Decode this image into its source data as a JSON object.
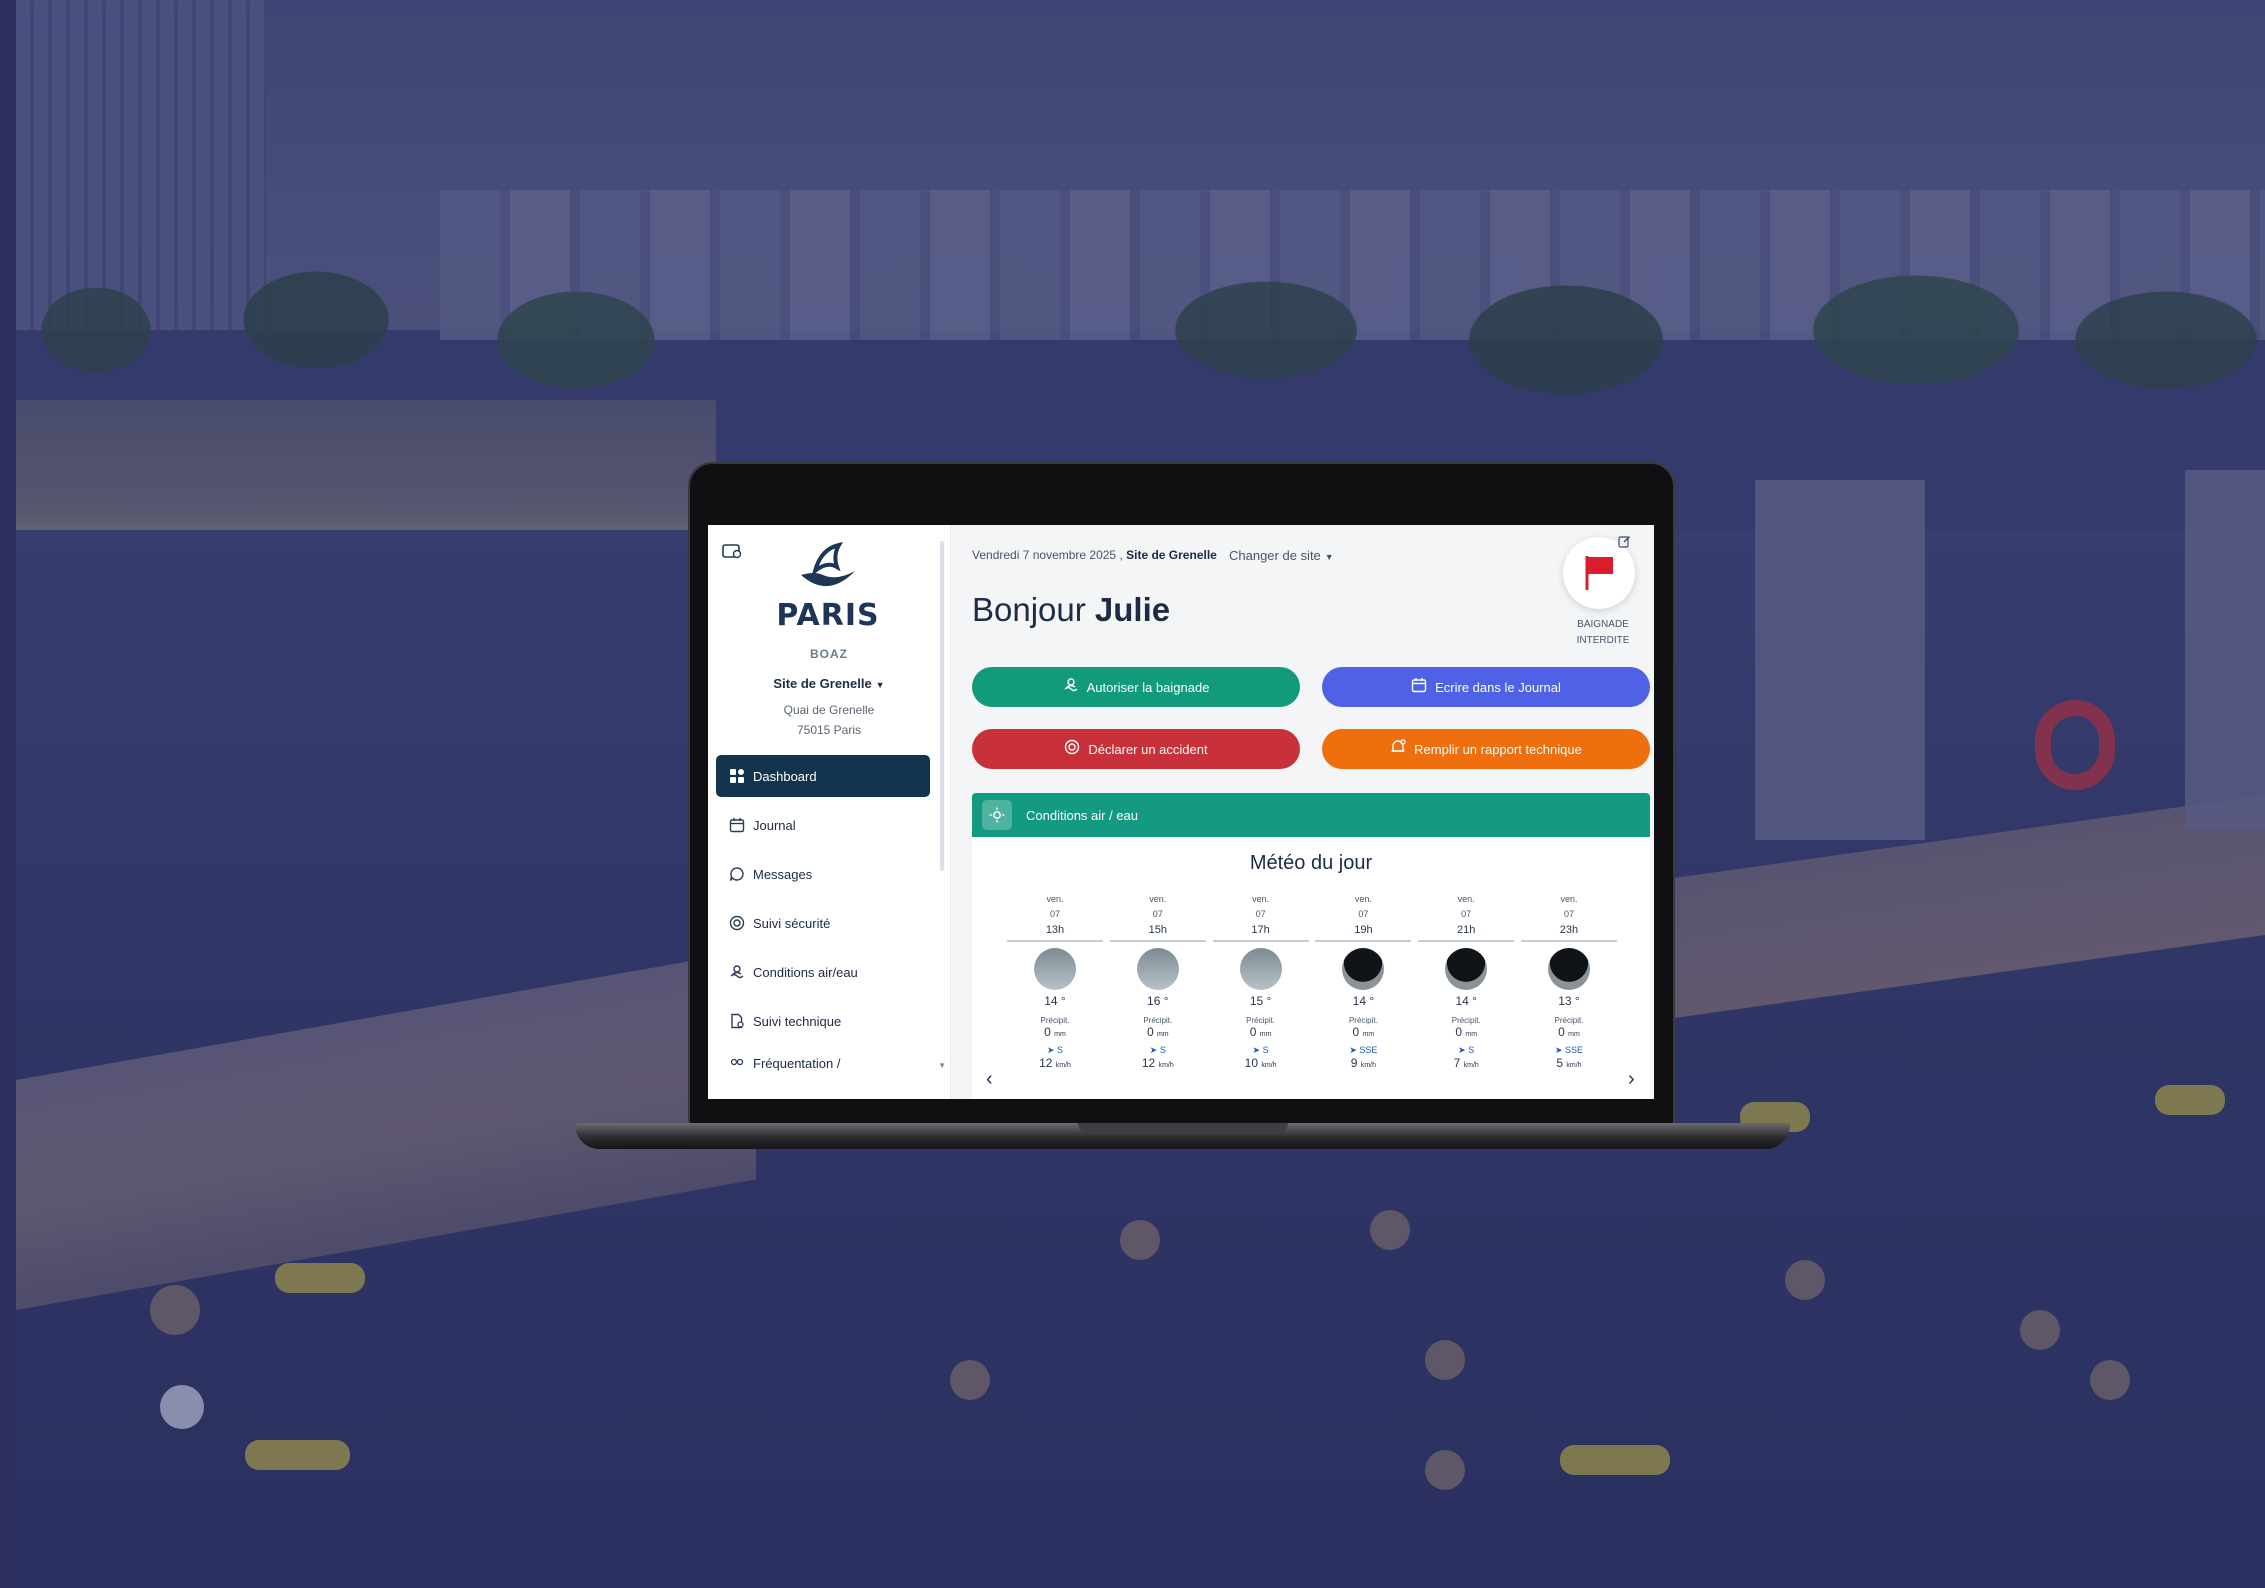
{
  "app": {
    "brand": "PARIS",
    "sub_brand": "BOAZ",
    "site_name": "Site de Grenelle",
    "site_address_line1": "Quai de Grenelle",
    "site_address_line2": "75015 Paris"
  },
  "sidebar": {
    "items": [
      {
        "label": "Dashboard",
        "icon": "grid-icon",
        "active": true
      },
      {
        "label": "Journal",
        "icon": "calendar-icon",
        "active": false
      },
      {
        "label": "Messages",
        "icon": "chat-icon",
        "active": false
      },
      {
        "label": "Suivi sécurité",
        "icon": "lifebuoy-icon",
        "active": false
      },
      {
        "label": "Conditions air/eau",
        "icon": "swimmer-icon",
        "active": false
      },
      {
        "label": "Suivi technique",
        "icon": "document-gear-icon",
        "active": false
      },
      {
        "label": "Fréquentation /",
        "icon": "people-icon",
        "active": false
      }
    ]
  },
  "header": {
    "date": "Vendredi 7 novembre 2025",
    "separator": " , ",
    "site": "Site de Grenelle",
    "change_site": "Changer de site",
    "greeting_prefix": "Bonjour ",
    "greeting_name": "Julie",
    "flag_status": "BAIGNADE INTERDITE",
    "flag_color": "#d81e2a"
  },
  "actions": {
    "authorize": "Autoriser la baignade",
    "journal": "Ecrire dans le Journal",
    "accident": "Déclarer un accident",
    "report": "Remplir un rapport technique"
  },
  "conditions": {
    "panel_title": "Conditions air / eau",
    "meteo_title": "Météo du jour",
    "precip_label": "Précipit.",
    "precip_unit": "mm",
    "wind_unit": "km/h",
    "forecast": [
      {
        "day": "ven.",
        "date": "07",
        "hour": "13h",
        "sky": "cloudy",
        "temp": "14 °",
        "precip": "0",
        "dir": "S",
        "wind": "12"
      },
      {
        "day": "ven.",
        "date": "07",
        "hour": "15h",
        "sky": "cloudy",
        "temp": "16 °",
        "precip": "0",
        "dir": "S",
        "wind": "12"
      },
      {
        "day": "ven.",
        "date": "07",
        "hour": "17h",
        "sky": "cloudy",
        "temp": "15 °",
        "precip": "0",
        "dir": "S",
        "wind": "10"
      },
      {
        "day": "ven.",
        "date": "07",
        "hour": "19h",
        "sky": "night",
        "temp": "14 °",
        "precip": "0",
        "dir": "SSE",
        "wind": "9"
      },
      {
        "day": "ven.",
        "date": "07",
        "hour": "21h",
        "sky": "night",
        "temp": "14 °",
        "precip": "0",
        "dir": "S",
        "wind": "7"
      },
      {
        "day": "ven.",
        "date": "07",
        "hour": "23h",
        "sky": "night",
        "temp": "13 °",
        "precip": "0",
        "dir": "SSE",
        "wind": "5"
      }
    ]
  },
  "colors": {
    "sidebar_active": "#12344d",
    "green": "#129a7c",
    "blue": "#4f62e6",
    "red": "#c8303a",
    "orange": "#ef6f0f",
    "panel_head": "#149a80"
  }
}
